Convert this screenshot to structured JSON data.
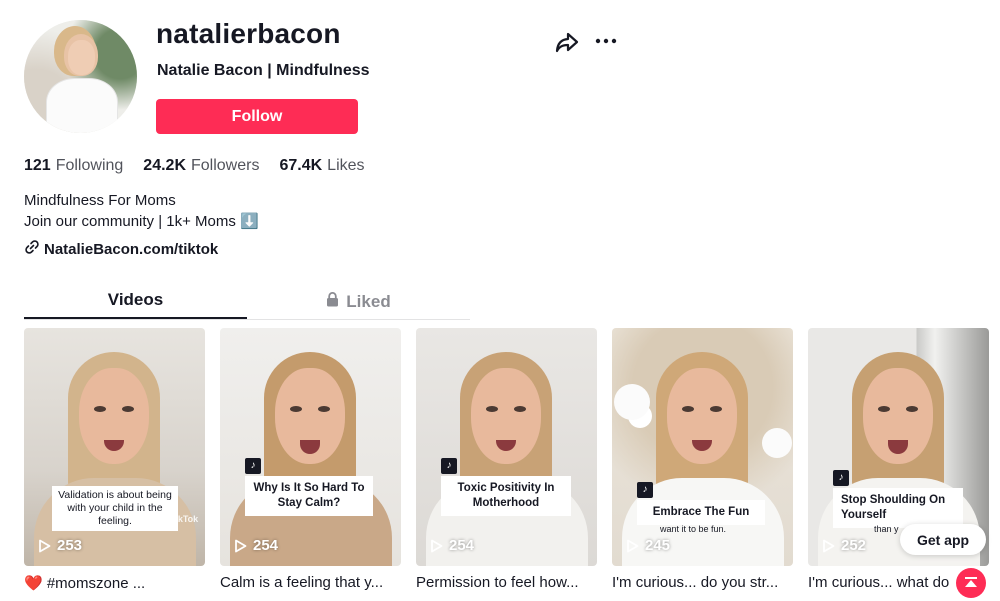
{
  "profile": {
    "username": "natalierbacon",
    "nickname": "Natalie Bacon | Mindfulness",
    "follow_label": "Follow",
    "stats": [
      {
        "value": "121",
        "label": "Following"
      },
      {
        "value": "24.2K",
        "label": "Followers"
      },
      {
        "value": "67.4K",
        "label": "Likes"
      }
    ],
    "bio_line1": "Mindfulness For Moms",
    "bio_line2": "Join our community | 1k+ Moms ⬇️",
    "link": "NatalieBacon.com/tiktok"
  },
  "tabs": {
    "videos": "Videos",
    "liked": "Liked"
  },
  "videos": [
    {
      "plays": "253",
      "caption": "Validation is about being with your child in the feeling.",
      "description": "❤️ #momszone ...",
      "watermark": "TikTok"
    },
    {
      "plays": "254",
      "caption": "Why Is It So Hard To Stay Calm?",
      "description": "Calm is a feeling that y..."
    },
    {
      "plays": "254",
      "caption": "Toxic Positivity In Motherhood",
      "description": "Permission to feel how..."
    },
    {
      "plays": "245",
      "caption": "Embrace The Fun",
      "subcaption": "want it to be fun.",
      "description": "I'm curious... do you str..."
    },
    {
      "plays": "252",
      "caption": "Stop Shoulding On Yourself",
      "subcaption": "than y",
      "description": "I'm curious... what do"
    }
  ],
  "get_app_label": "Get app",
  "colors": {
    "accent": "#fe2c55",
    "text": "#161823"
  }
}
